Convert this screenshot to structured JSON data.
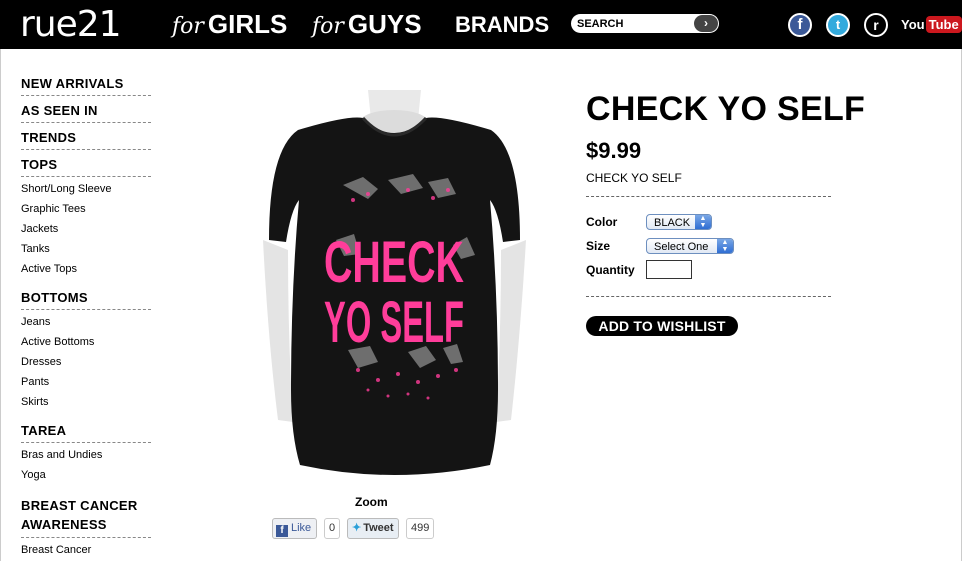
{
  "header": {
    "logo": "rue21",
    "nav": [
      {
        "prefix": "for",
        "label": "GIRLS"
      },
      {
        "prefix": "for",
        "label": "GUYS"
      },
      {
        "label": "BRANDS"
      }
    ],
    "search_placeholder": "SEARCH",
    "social": {
      "facebook": "f",
      "twitter": "t",
      "rue": "r",
      "youtube_you": "You",
      "youtube_tube": "Tube"
    }
  },
  "sidebar": [
    {
      "label": "NEW ARRIVALS",
      "items": []
    },
    {
      "label": "AS SEEN IN",
      "items": []
    },
    {
      "label": "TRENDS",
      "items": []
    },
    {
      "label": "TOPS",
      "items": [
        "Short/Long Sleeve",
        "Graphic Tees",
        "Jackets",
        "Tanks",
        "Active Tops"
      ]
    },
    {
      "label": "BOTTOMS",
      "items": [
        "Jeans",
        "Active Bottoms",
        "Dresses",
        "Pants",
        "Skirts"
      ]
    },
    {
      "label": "TAREA",
      "items": [
        "Bras and Undies",
        "Yoga"
      ]
    },
    {
      "label": "BREAST CANCER AWARENESS",
      "items": [
        "Breast Cancer"
      ]
    }
  ],
  "product": {
    "image_text_line1": "CHECK",
    "image_text_line2": "YO SELF",
    "zoom_label": "Zoom",
    "like_label": "Like",
    "like_count": "0",
    "tweet_label": "Tweet",
    "tweet_count": "499",
    "title": "CHECK YO SELF",
    "price": "$9.99",
    "name": "CHECK YO SELF",
    "color_label": "Color",
    "color_value": "BLACK",
    "size_label": "Size",
    "size_value": "Select One",
    "quantity_label": "Quantity",
    "quantity_value": "",
    "wishlist_label": "ADD TO WISHLIST"
  },
  "colors": {
    "topbar": "#000000",
    "text_pink": "#ff3d9a",
    "facebook": "#3b5998",
    "twitter": "#33aadd",
    "youtube": "#cc181e"
  }
}
